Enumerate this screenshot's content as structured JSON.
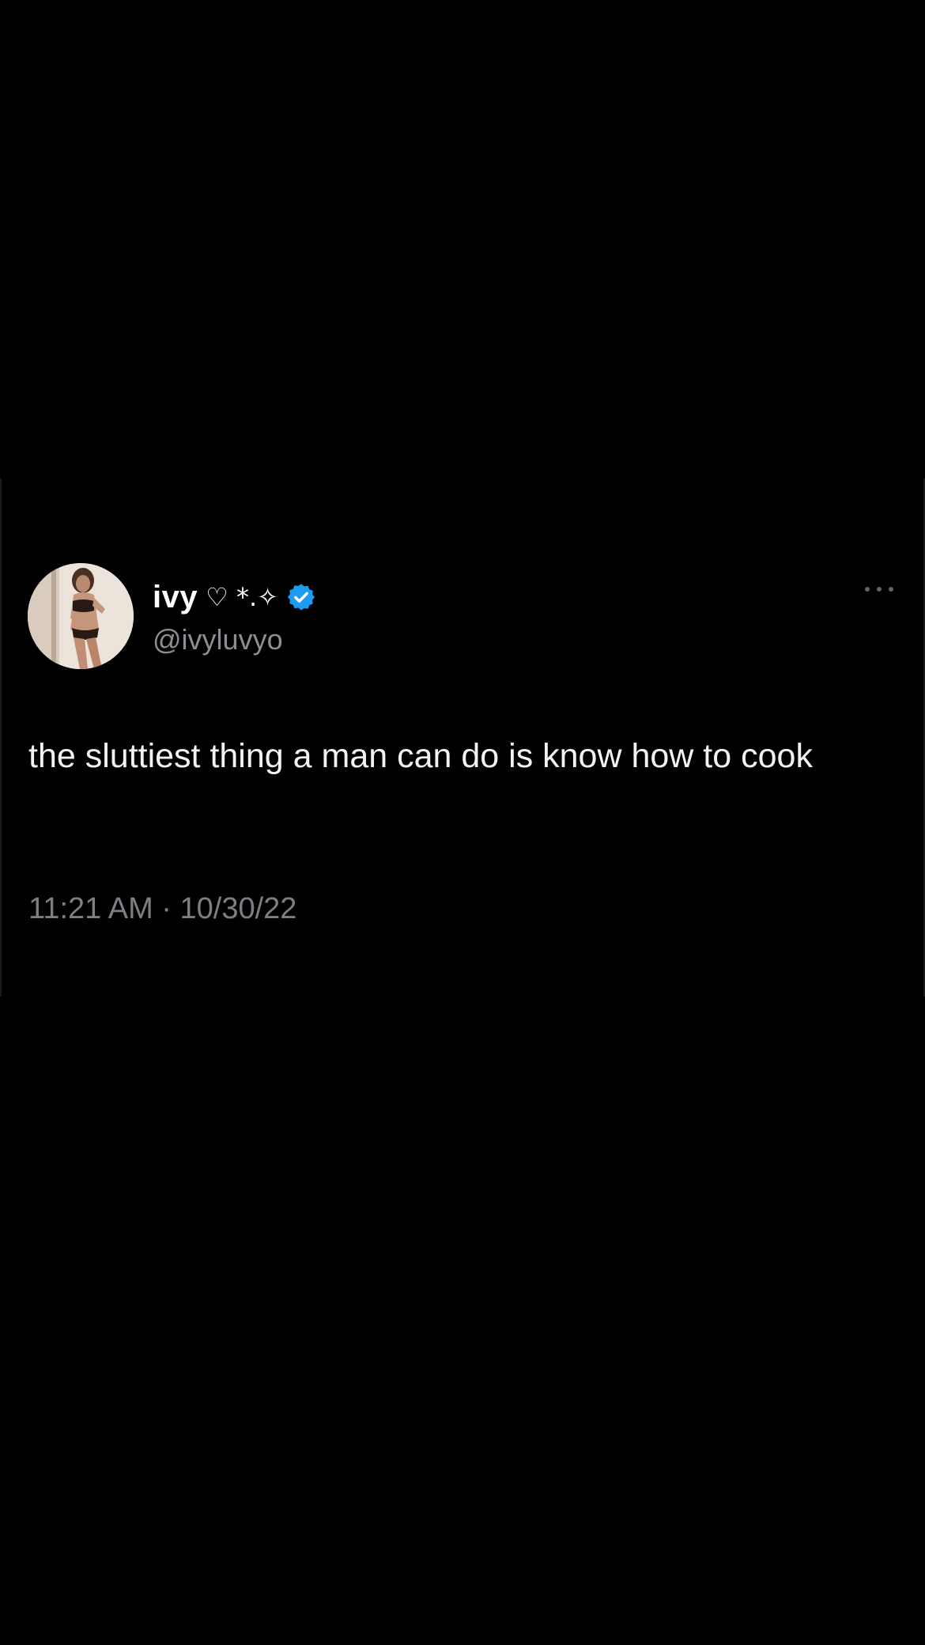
{
  "tweet": {
    "display_name": "ivy",
    "name_decoration": "♡ *.✧",
    "handle": "@ivyluvyo",
    "verified": true,
    "text": "the sluttiest thing a man can do is know how to cook",
    "timestamp": "11:21 AM · 10/30/22"
  },
  "icons": {
    "verified": "verified-badge-icon",
    "more": "more-options-icon"
  },
  "colors": {
    "background": "#000000",
    "text_primary": "#f2f2f2",
    "text_secondary": "#8b8e93",
    "verified_blue": "#1d9bf0"
  }
}
